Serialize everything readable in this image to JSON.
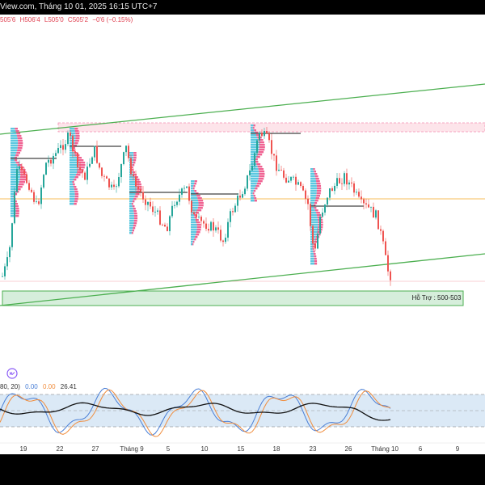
{
  "header": {
    "source_text": "View.com, Tháng 10 01, 2025 16:15 UTC+7"
  },
  "ohlc": {
    "open_partial": "505'6",
    "high": "H506'4",
    "low": "L505'0",
    "close": "C505'2",
    "change": "−0'6 (−0.15%)"
  },
  "support_zone": {
    "label": "Hỗ Trợ : 500-503",
    "low": 500,
    "high": 503
  },
  "indicator": {
    "params": "80, 20)",
    "value_blue": "0.00",
    "value_orange": "0.00",
    "value_black": "26.41"
  },
  "x_axis": {
    "labels": [
      "19",
      "22",
      "27",
      "Tháng 9",
      "5",
      "10",
      "15",
      "18",
      "23",
      "26",
      "Tháng 10",
      "6",
      "9"
    ]
  },
  "colors": {
    "up": "#26a69a",
    "down": "#ef5350",
    "channel": "#4caf50",
    "resistance": "#f48fb1",
    "support_fill": "#d6eedb",
    "orange_line": "#f5a623",
    "stoch_blue": "#4a7fd6",
    "stoch_orange": "#f08c3c",
    "stoch_band": "#dbe9f6"
  },
  "icons": {
    "indicator_toggle": "chevron-icon"
  }
}
